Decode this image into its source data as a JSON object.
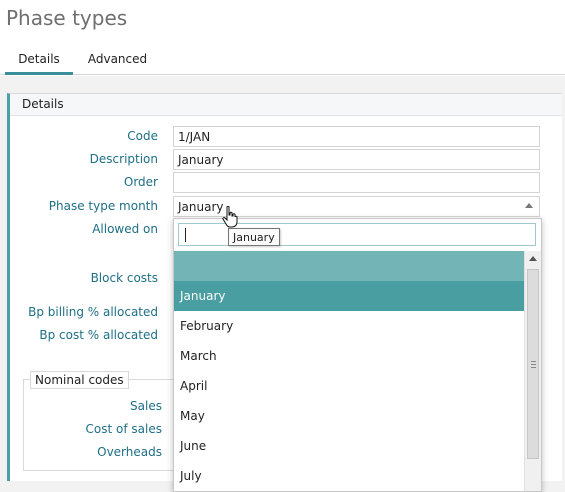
{
  "page": {
    "title": "Phase types"
  },
  "tabs": [
    {
      "label": "Details",
      "active": true
    },
    {
      "label": "Advanced",
      "active": false
    }
  ],
  "panel": {
    "header": "Details"
  },
  "form": {
    "code": {
      "label": "Code",
      "value": "1/JAN"
    },
    "description": {
      "label": "Description",
      "value": "January"
    },
    "order": {
      "label": "Order",
      "value": ""
    },
    "phase_type_month": {
      "label": "Phase type month",
      "value": "January"
    },
    "allowed_on": {
      "label": "Allowed on"
    },
    "block_costs": {
      "label": "Block costs"
    },
    "bp_billing": {
      "label": "Bp billing % allocated"
    },
    "bp_cost": {
      "label": "Bp cost % allocated"
    }
  },
  "nominal_codes": {
    "legend": "Nominal codes",
    "sales": "Sales",
    "cost_of_sales": "Cost of sales",
    "overheads": "Overheads"
  },
  "dropdown": {
    "search_value": "",
    "options": [
      "",
      "January",
      "February",
      "March",
      "April",
      "May",
      "June",
      "July"
    ],
    "selected": "January"
  },
  "tooltip": {
    "text": "January"
  },
  "colors": {
    "accent": "#3a8f99",
    "label": "#1e6f86",
    "selected_bg": "#489ea0",
    "blank_bg": "#73b4b6"
  }
}
